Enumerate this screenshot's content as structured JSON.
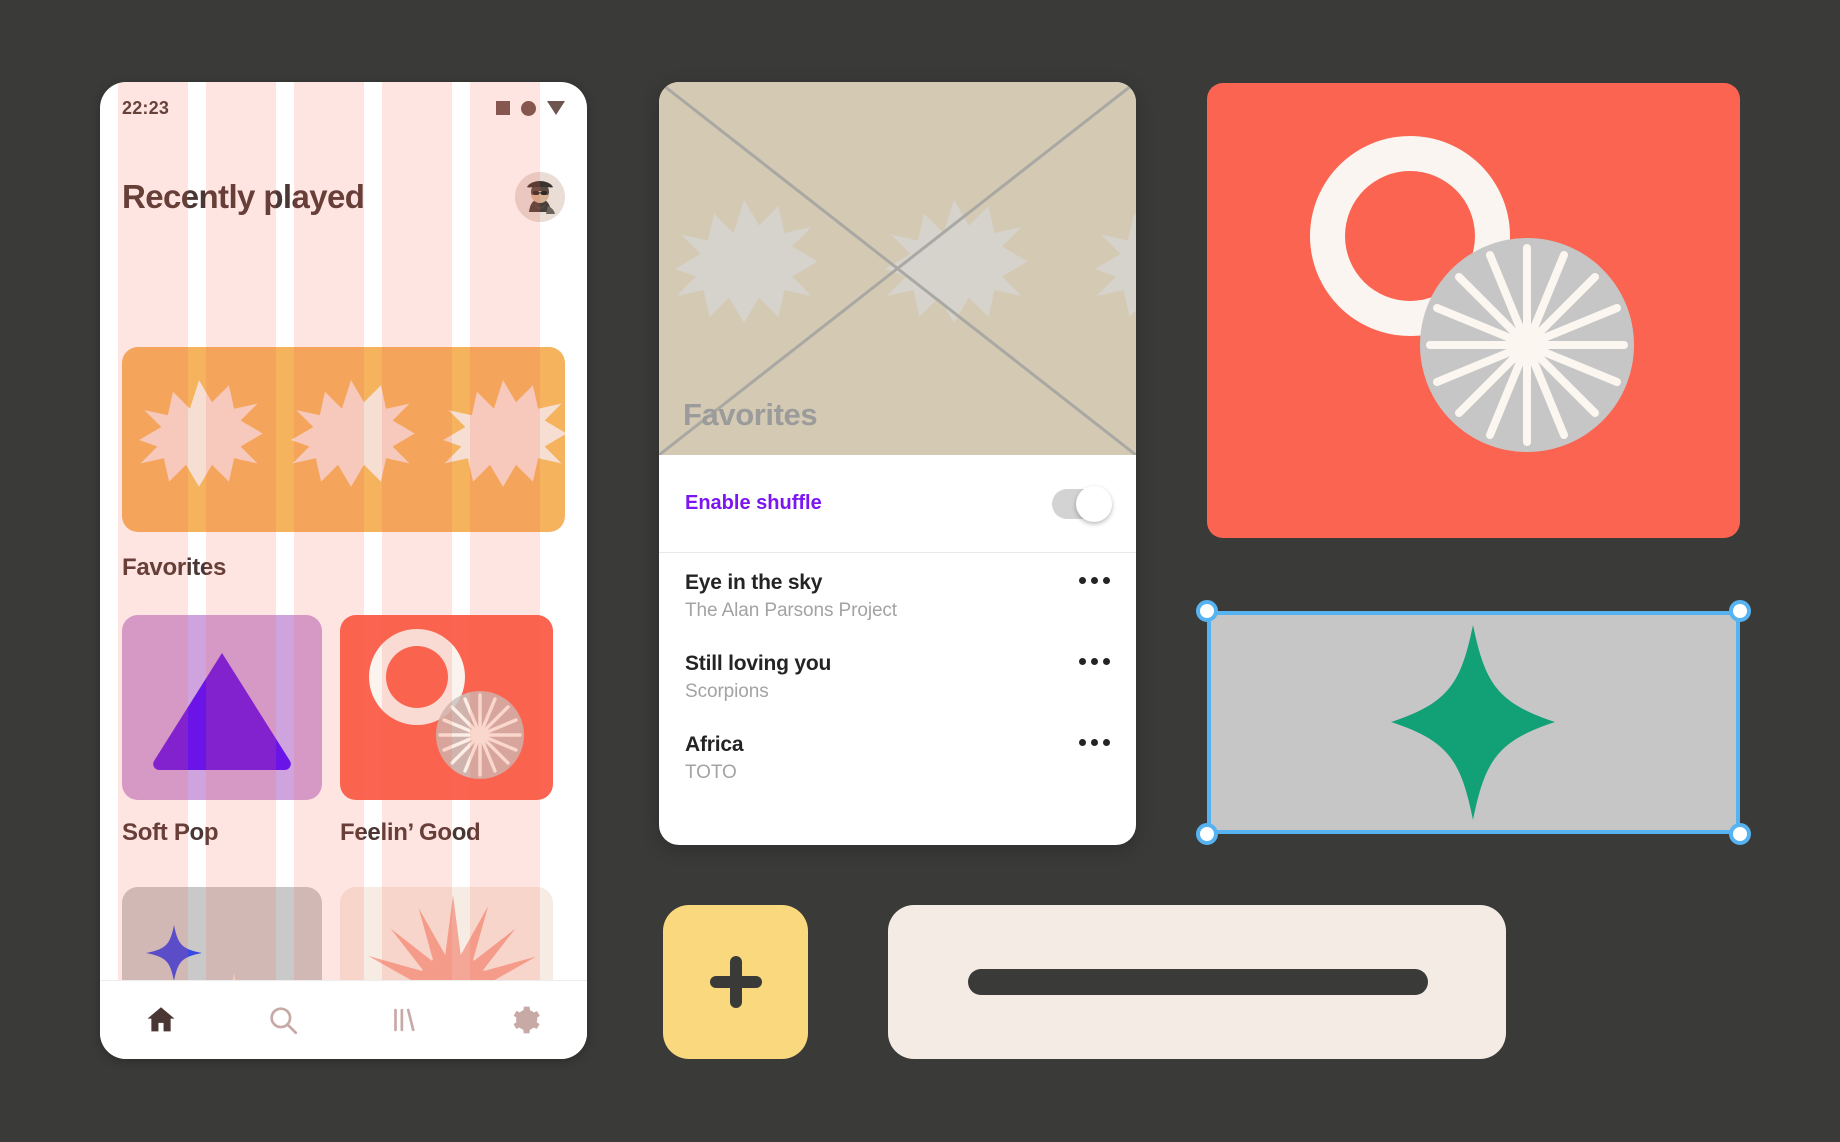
{
  "canvas": {
    "background": "#3a3a38"
  },
  "phone": {
    "statusbar": {
      "time": "22:23",
      "icons": [
        "square-icon",
        "circle-icon",
        "triangle-down-icon"
      ]
    },
    "header": {
      "title": "Recently played",
      "avatar_name": "user-avatar"
    },
    "hero": {
      "name": "recently-played-hero-card",
      "background": "#f5b35e",
      "glyph": "asterisk-burst"
    },
    "sections": [
      {
        "label": "Favorites",
        "tiles": [
          {
            "label": "Soft Pop",
            "background": "#cfa3dd",
            "shape": "triangle",
            "shape_color": "#6a14e8"
          },
          {
            "label": "Feelin’ Good",
            "background": "#fa6450",
            "shape": "ring-and-sunburst"
          }
        ]
      },
      {
        "label": "",
        "tiles": [
          {
            "label": "",
            "background": "#c9c9c9",
            "shape": "four-point-stars"
          },
          {
            "label": "",
            "background": "#f7ece4",
            "shape": "starburst"
          }
        ]
      }
    ],
    "nav": [
      {
        "name": "nav-home",
        "icon": "home-icon",
        "active": true
      },
      {
        "name": "nav-search",
        "icon": "search-icon",
        "active": false
      },
      {
        "name": "nav-library",
        "icon": "library-icon",
        "active": false
      },
      {
        "name": "nav-settings",
        "icon": "gear-icon",
        "active": false
      }
    ],
    "grid_overlay": {
      "name": "layout-grid-overlay",
      "stripe_color": "#fa6450",
      "stripe_opacity": "0.17",
      "columns": 5
    }
  },
  "favorites_panel": {
    "cover": {
      "label": "Favorites",
      "placeholder": "broken-image-placeholder",
      "background": "#d4c9b3"
    },
    "shuffle": {
      "label": "Enable shuffle",
      "label_color": "#7b16f2",
      "enabled": false
    },
    "tracks": [
      {
        "title": "Eye in the sky",
        "artist": "The Alan Parsons Project",
        "menu": "overflow-menu"
      },
      {
        "title": "Still loving you",
        "artist": "Scorpions",
        "menu": "overflow-menu"
      },
      {
        "title": "Africa",
        "artist": "TOTO",
        "menu": "overflow-menu"
      }
    ]
  },
  "canvas_objects": {
    "red_card": {
      "name": "ring-sunburst-artwork",
      "background": "#fa6450",
      "ring_color": "#faf5f0",
      "sunburst_circle": "#c6c6c6"
    },
    "selected_card": {
      "name": "green-star-artwork",
      "background": "#c6c6c6",
      "shape_color": "#12a077",
      "selected": true,
      "selection_color": "#56b2f0",
      "handles": 4
    },
    "add_button": {
      "name": "add-button",
      "background": "#fad87e",
      "icon": "plus-icon",
      "icon_color": "#3a3a38"
    },
    "divider_card": {
      "name": "divider-bar-card",
      "background": "#f4ece4",
      "line_color": "#3a3a38"
    }
  }
}
